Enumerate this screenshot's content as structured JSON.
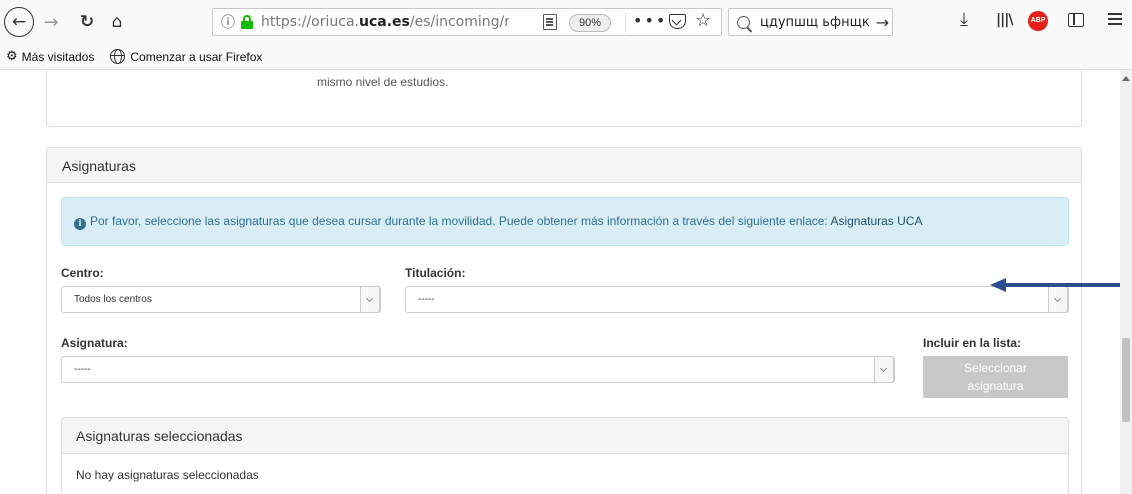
{
  "browser": {
    "url_prefix": "https://oriuca.",
    "url_domain": "uca.es",
    "url_suffix": "/es/incoming/re",
    "zoom": "90%",
    "page_actions": "•••",
    "search_text": "цдупшщ ьфнщк",
    "abp_label": "ABP"
  },
  "bookmarks": {
    "items": [
      {
        "label": "Más visitados"
      },
      {
        "label": "Comenzar a usar Firefox"
      }
    ]
  },
  "page": {
    "previous_text": "mismo nivel de estudios.",
    "panel_title": "Asignaturas",
    "alert_text": "Por favor, seleccione las asignaturas que desea cursar durante la movilidad. Puede obtener más información a través del siguiente enlace: ",
    "alert_link": "Asignaturas UCA",
    "centro_label": "Centro:",
    "centro_value": "Todos los centros",
    "titulacion_label": "Titulación:",
    "titulacion_value": "-----",
    "asignatura_label": "Asignatura:",
    "asignatura_value": "-----",
    "incluir_label": "Incluir en la lista:",
    "select_button_line1": "Seleccionar",
    "select_button_line2": "asignatura",
    "selected_title": "Asignaturas seleccionadas",
    "selected_empty": "No hay asignaturas seleccionadas"
  },
  "colors": {
    "alert_bg": "#d9edf7",
    "alert_text": "#31708f",
    "annotation_arrow": "#2e4f8f",
    "secure_lock": "#12bc00",
    "abp_red": "#e61e17"
  }
}
